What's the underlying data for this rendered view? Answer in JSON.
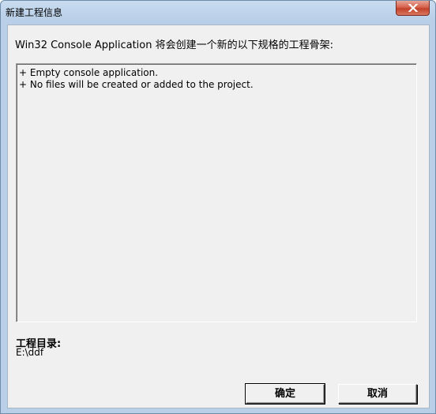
{
  "window": {
    "title": "新建工程信息"
  },
  "description": "Win32 Console Application 将会创建一个新的以下规格的工程骨架:",
  "info_lines": [
    "+ Empty console application.",
    "+ No files will be created or added to the project."
  ],
  "project_dir": {
    "label": "工程目录:",
    "value": "E:\\ddf"
  },
  "buttons": {
    "ok_label": "确定",
    "cancel_label": "取消"
  },
  "icons": {
    "close": "close-icon"
  }
}
